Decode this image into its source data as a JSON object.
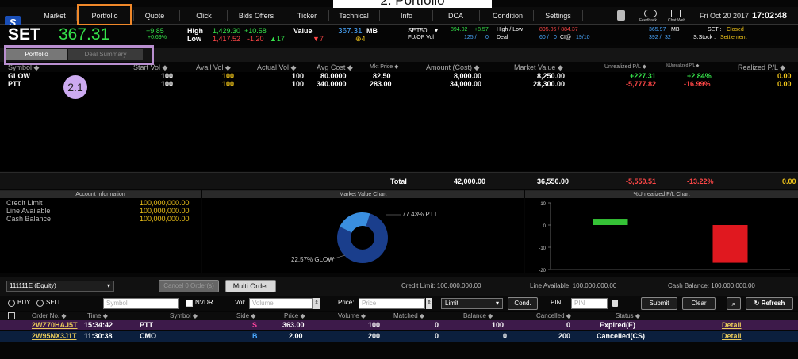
{
  "caption": "2. Portfolio",
  "nav": {
    "logo": "S",
    "items": [
      "Market",
      "Portfolio",
      "Quote",
      "Click",
      "Bids Offers",
      "Ticker",
      "Technical",
      "Info",
      "DCA",
      "Condition",
      "Settings"
    ],
    "icon_labels": [
      "Feedback",
      "Chat Web"
    ],
    "date": "Fri Oct 20 2017",
    "time": "17:02:48"
  },
  "index": {
    "name": "SET",
    "value": "367.31",
    "change": "+9.85",
    "change_pct": "+0.69%",
    "high_label": "High",
    "high": "1,429.30",
    "high_chg": "+10.58",
    "low_label": "Low",
    "low": "1,417.52",
    "low_chg": "-1.20",
    "up": "▲17",
    "down": "▼7",
    "unch": "⊕4",
    "value_label": "Value",
    "value_unit": "MB",
    "set50_label": "SET50",
    "set50_value": "894.02",
    "set50_chg": "+8.57",
    "fund_label": "FU/OP Vol",
    "fund_val": "125 /",
    "fund_val2": "0",
    "deal_label": "Deal",
    "deal_val": "60 /",
    "deal_val2": "0",
    "ci_label": "CI@",
    "ci_val": "19/10",
    "hl_label": "High / Low",
    "hl_val": "895.06 / 884.37",
    "set_val": "365.97",
    "set_val2": "392 /",
    "set_val3": "32",
    "mb": "MB",
    "status_label": "SET :",
    "status": "Closed",
    "sstock_label": "S.Stock :",
    "sstock": "Settlement"
  },
  "tabs": [
    "Portfolio",
    "Deal Summary"
  ],
  "columns": [
    "Symbol ◆",
    "Start Vol ◆",
    "Avail Vol ◆",
    "Actual Vol ◆",
    "Avg Cost ◆",
    "Mkt Price ◆",
    "Amount (Cost) ◆",
    "Market Value ◆",
    "Unrealized P/L ◆",
    "%Unrealized P/L ◆",
    "Realized P/L ◆"
  ],
  "rows": [
    {
      "symbol": "GLOW",
      "start": "100",
      "avail": "100",
      "actual": "100",
      "avg": "80.0000",
      "mkt": "82.50",
      "amount": "8,000.00",
      "mv": "8,250.00",
      "upl": "+227.31",
      "uplp": "+2.84%",
      "rpl": "0.00"
    },
    {
      "symbol": "PTT",
      "start": "100",
      "avail": "100",
      "actual": "100",
      "avg": "340.0000",
      "mkt": "283.00",
      "amount": "34,000.00",
      "mv": "28,300.00",
      "upl": "-5,777.82",
      "uplp": "-16.99%",
      "rpl": "0.00"
    }
  ],
  "total": {
    "label": "Total",
    "amount": "42,000.00",
    "mv": "36,550.00",
    "upl": "-5,550.51",
    "uplp": "-13.22%",
    "rpl": "0.00"
  },
  "account": {
    "title": "Account Information",
    "items": [
      {
        "label": "Credit Limit",
        "value": "100,000,000.00"
      },
      {
        "label": "Line Available",
        "value": "100,000,000.00"
      },
      {
        "label": "Cash Balance",
        "value": "100,000,000.00"
      }
    ]
  },
  "mv_chart": {
    "title": "Market Value Chart",
    "slices": [
      {
        "label": "PTT",
        "pct": 77.43,
        "text": "77.43% PTT",
        "color": "#1a3e8c"
      },
      {
        "label": "GLOW",
        "pct": 22.57,
        "text": "22.57% GLOW",
        "color": "#3a8fe0"
      }
    ]
  },
  "pl_chart": {
    "title": "%Unrealized P/L Chart",
    "ticks": [
      "10",
      "0",
      "-10",
      "-20"
    ],
    "ylim": [
      -20,
      10
    ],
    "bars": [
      {
        "label": "GLOW",
        "value": 2.84,
        "color": "#35c236"
      },
      {
        "label": "PTT",
        "value": -16.99,
        "color": "#e0181f"
      }
    ]
  },
  "orderbar": {
    "account": "111111E (Equity)",
    "cancel": "Cancel 0 Order(s)",
    "multi": "Multi Order",
    "credit": "Credit Limit: 100,000,000.00",
    "line": "Line Available: 100,000,000.00",
    "cash": "Cash Balance: 100,000,000.00"
  },
  "entry": {
    "buy": "BUY",
    "sell": "SELL",
    "symbol_ph": "Symbol",
    "nvdr": "NVDR",
    "vol_label": "Vol:",
    "vol_ph": "Volume",
    "price_label": "Price:",
    "price_ph": "Price",
    "type": "Limit",
    "cond": "Cond.",
    "pin_label": "PIN:",
    "pin_ph": "PIN",
    "submit": "Submit",
    "clear": "Clear",
    "refresh": "Refresh"
  },
  "ord_columns": [
    "Order No. ◆",
    "Time ◆",
    "Symbol ◆",
    "Side ◆",
    "Price ◆",
    "Volume ◆",
    "Matched ◆",
    "Balance ◆",
    "Cancelled ◆",
    "Status ◆"
  ],
  "orders": [
    {
      "no": "2WZ70HAJ5T",
      "time": "15:34:42",
      "symbol": "PTT",
      "side": "S",
      "price": "363.00",
      "vol": "100",
      "matched": "0",
      "balance": "100",
      "cancelled": "0",
      "status": "Expired(E)",
      "detail": "Detail"
    },
    {
      "no": "2W95NX3J1T",
      "time": "11:30:38",
      "symbol": "CMO",
      "side": "B",
      "price": "2.00",
      "vol": "200",
      "matched": "0",
      "balance": "0",
      "cancelled": "200",
      "status": "Cancelled(CS)",
      "detail": "Detail"
    }
  ],
  "annotation": "2.1",
  "colors": {
    "up": "#35e24a",
    "down": "#ff4747",
    "unchanged": "#f0c419",
    "highlight_nav": "#f0882a",
    "highlight_tab": "#b98fd0"
  }
}
